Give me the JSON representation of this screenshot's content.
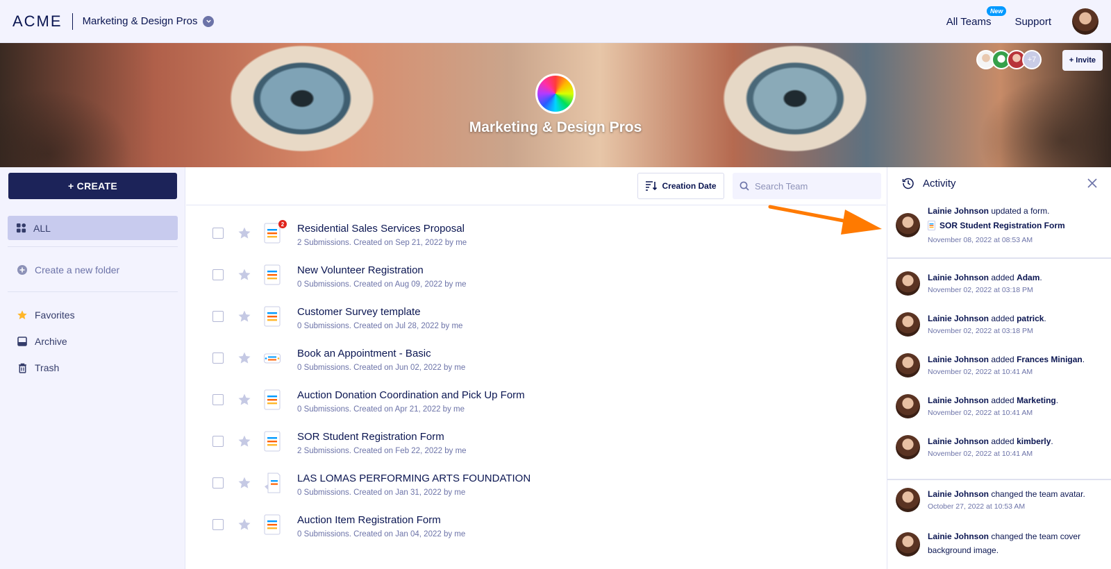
{
  "header": {
    "logo": "ACME",
    "team_name": "Marketing & Design Pros",
    "all_teams": "All Teams",
    "new_badge": "New",
    "support": "Support"
  },
  "banner": {
    "title": "Marketing & Design Pros",
    "members_more": "+7",
    "invite": "+ Invite"
  },
  "sidebar": {
    "create": "+ CREATE",
    "all": "ALL",
    "new_folder": "Create a new folder",
    "favorites": "Favorites",
    "archive": "Archive",
    "trash": "Trash"
  },
  "toolbar": {
    "sort_label": "Creation Date",
    "search_placeholder": "Search Team"
  },
  "forms": [
    {
      "title": "Residential Sales Services Proposal",
      "meta": "2 Submissions. Created on Sep 21, 2022 by me",
      "badge": "2"
    },
    {
      "title": "New Volunteer Registration",
      "meta": "0 Submissions. Created on Aug 09, 2022 by me"
    },
    {
      "title": "Customer Survey template",
      "meta": "0 Submissions. Created on Jul 28, 2022 by me"
    },
    {
      "title": "Book an Appointment - Basic",
      "meta": "0 Submissions. Created on Jun 02, 2022 by me"
    },
    {
      "title": "Auction Donation Coordination and Pick Up Form",
      "meta": "0 Submissions. Created on Apr 21, 2022 by me"
    },
    {
      "title": "SOR Student Registration Form",
      "meta": "2 Submissions. Created on Feb 22, 2022 by me"
    },
    {
      "title": "LAS LOMAS PERFORMING ARTS FOUNDATION",
      "meta": "0 Submissions. Created on Jan 31, 2022 by me"
    },
    {
      "title": "Auction Item Registration Form",
      "meta": "0 Submissions. Created on Jan 04, 2022 by me"
    }
  ],
  "activity": {
    "title": "Activity",
    "items": [
      {
        "user": "Lainie Johnson",
        "action": " updated a form.",
        "target": "",
        "after": "",
        "sub": "SOR Student Registration Form",
        "date": "November 08, 2022 at 08:53 AM"
      },
      {
        "user": "Lainie Johnson",
        "action": " added ",
        "target": "Adam",
        "after": ".",
        "date": "November 02, 2022 at 03:18 PM"
      },
      {
        "user": "Lainie Johnson",
        "action": " added ",
        "target": "patrick",
        "after": ".",
        "date": "November 02, 2022 at 03:18 PM"
      },
      {
        "user": "Lainie Johnson",
        "action": " added ",
        "target": "Frances Minigan",
        "after": ".",
        "date": "November 02, 2022 at 10:41 AM"
      },
      {
        "user": "Lainie Johnson",
        "action": " added ",
        "target": "Marketing",
        "after": ".",
        "date": "November 02, 2022 at 10:41 AM"
      },
      {
        "user": "Lainie Johnson",
        "action": " added ",
        "target": "kimberly",
        "after": ".",
        "date": "November 02, 2022 at 10:41 AM"
      },
      {
        "user": "Lainie Johnson",
        "action": " changed the team avatar.",
        "target": "",
        "after": "",
        "date": "October 27, 2022 at 10:53 AM"
      },
      {
        "user": "Lainie Johnson",
        "action": " changed the team cover background image.",
        "target": "",
        "after": "",
        "date": ""
      }
    ]
  },
  "colors": {
    "navy": "#0a1551",
    "create_button": "#1c2359",
    "sidebar_bg": "#f3f3fe",
    "selected_nav": "#c8cbee",
    "arrow": "#ff7a00",
    "badge_red": "#e0241c",
    "new_badge_blue": "#0099ff"
  }
}
